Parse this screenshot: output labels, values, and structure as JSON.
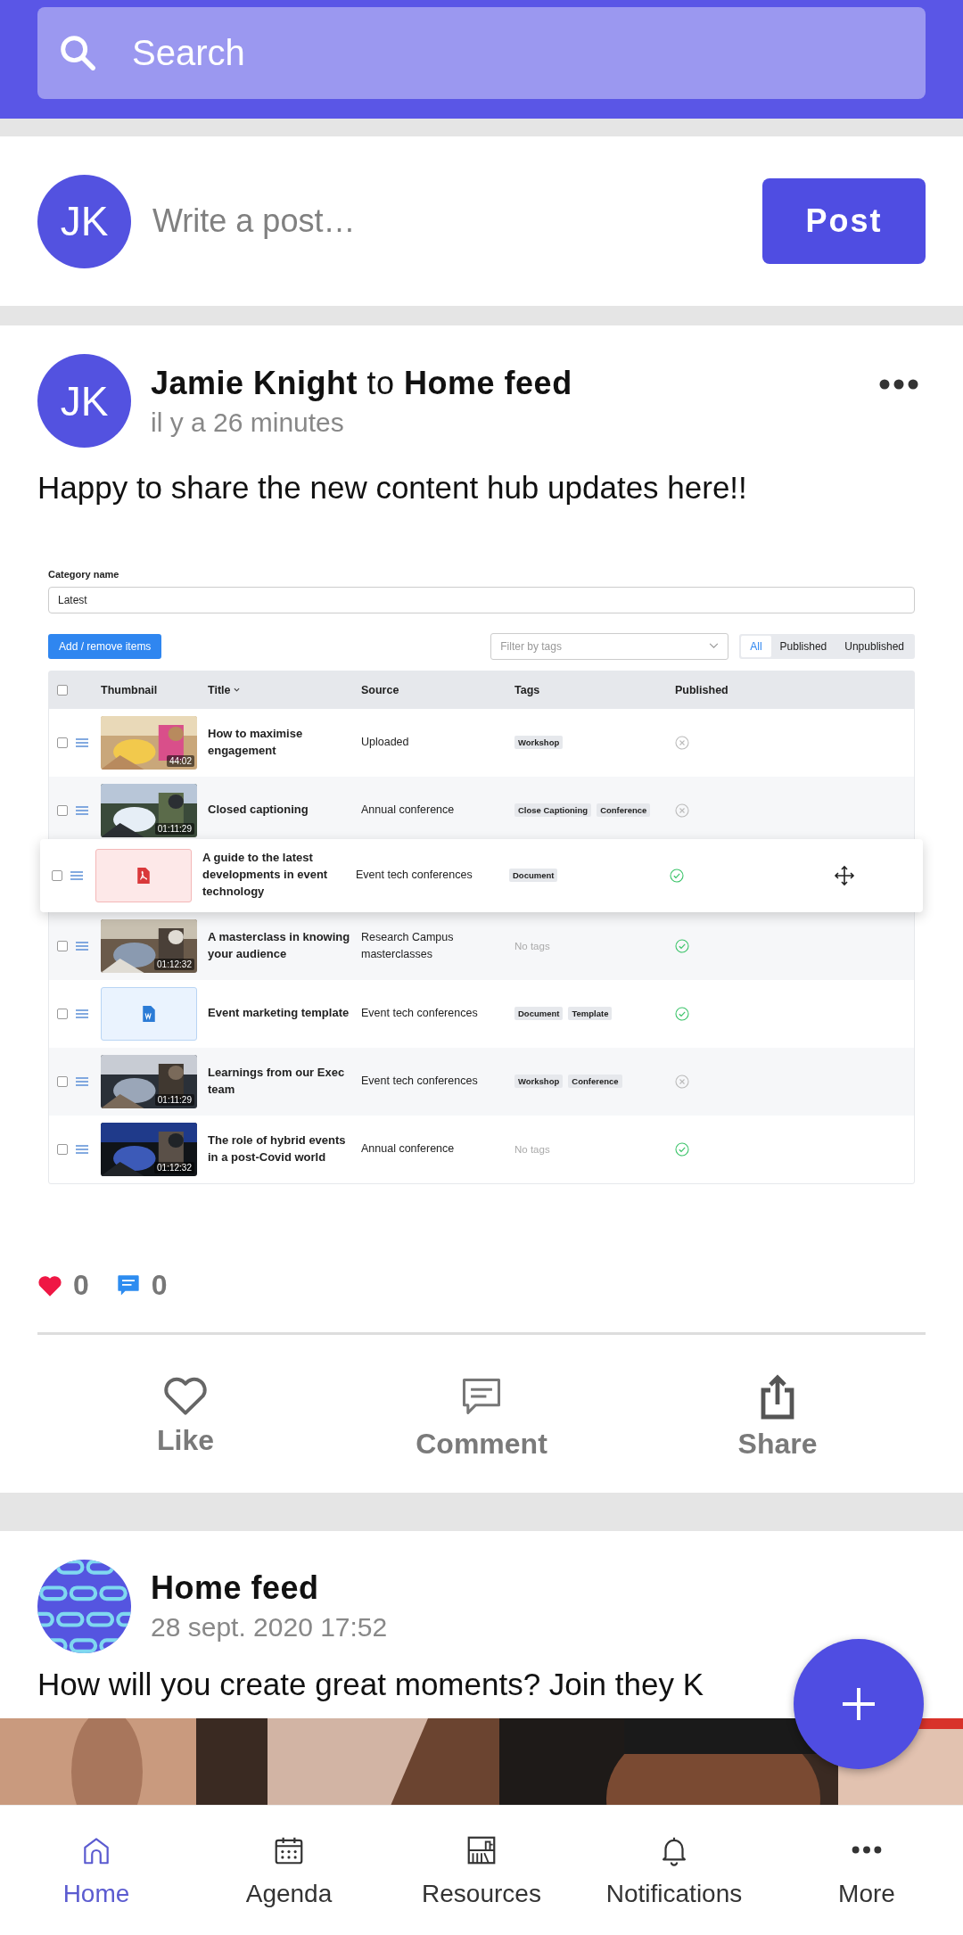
{
  "search": {
    "placeholder": "Search"
  },
  "composer": {
    "avatar": "JK",
    "placeholder": "Write a post…",
    "button": "Post"
  },
  "post": {
    "avatar": "JK",
    "title": "**Jamie Knight** to **Home feed**",
    "time": "il y a 26 minutes",
    "text": "Happy to share the new content hub updates here!!",
    "attachment": {
      "category_label": "Category name",
      "category_value": "Latest",
      "add_button": "Add / remove items",
      "filter_placeholder": "Filter by tags",
      "segments": [
        {
          "label": "All",
          "selected": true
        },
        {
          "label": "Published",
          "selected": false
        },
        {
          "label": "Unpublished",
          "selected": false
        }
      ],
      "header_checked": false,
      "columns": [
        "Thumbnail",
        "Title",
        "Source",
        "Tags",
        "Published"
      ],
      "rows": [
        {
          "kind": "video",
          "duration": "44:02",
          "title": "How to maximise engagement",
          "source": "Uploaded",
          "tags": [
            "Workshop"
          ],
          "published": false,
          "checked": false,
          "dragging": false
        },
        {
          "kind": "video",
          "duration": "01:11:29",
          "title": "Closed captioning",
          "source": "Annual conference",
          "tags": [
            "Close Captioning",
            "Conference"
          ],
          "published": false,
          "checked": false,
          "dragging": false
        },
        {
          "kind": "pdf",
          "title": "A guide to the latest developments in event technology",
          "source": "Event tech conferences",
          "tags": [
            "Document"
          ],
          "published": true,
          "checked": false,
          "dragging": true
        },
        {
          "kind": "video",
          "duration": "01:12:32",
          "title": "A masterclass in knowing your audience",
          "source": "Research Campus masterclasses",
          "no_tags": "No tags",
          "published": true,
          "checked": false,
          "dragging": false
        },
        {
          "kind": "word",
          "title": "Event marketing template",
          "source": "Event tech conferences",
          "tags": [
            "Document",
            "Template"
          ],
          "published": true,
          "checked": false,
          "dragging": false
        },
        {
          "kind": "video",
          "duration": "01:11:29",
          "title": "Learnings from our Exec team",
          "source": "Event tech conferences",
          "tags": [
            "Workshop",
            "Conference"
          ],
          "published": false,
          "checked": false,
          "dragging": false
        },
        {
          "kind": "video",
          "duration": "01:12:32",
          "title": "The role of hybrid events in a post-Covid world",
          "source": "Annual conference",
          "no_tags": "No tags",
          "published": true,
          "checked": false,
          "dragging": false
        }
      ]
    },
    "likes": "0",
    "comments": "0",
    "actions": [
      {
        "kind": "like",
        "label": "Like"
      },
      {
        "kind": "comment",
        "label": "Comment"
      },
      {
        "kind": "share",
        "label": "Share"
      }
    ]
  },
  "next_post": {
    "title": "Home feed",
    "time": "28 sept. 2020 17:52",
    "text": "How will you create great moments? Join they K"
  },
  "nav": [
    {
      "kind": "home",
      "label": "Home",
      "selected": true
    },
    {
      "kind": "agenda",
      "label": "Agenda",
      "selected": false
    },
    {
      "kind": "resources",
      "label": "Resources",
      "selected": false
    },
    {
      "kind": "notifications",
      "label": "Notifications",
      "selected": false
    },
    {
      "kind": "more",
      "label": "More",
      "selected": false
    }
  ]
}
